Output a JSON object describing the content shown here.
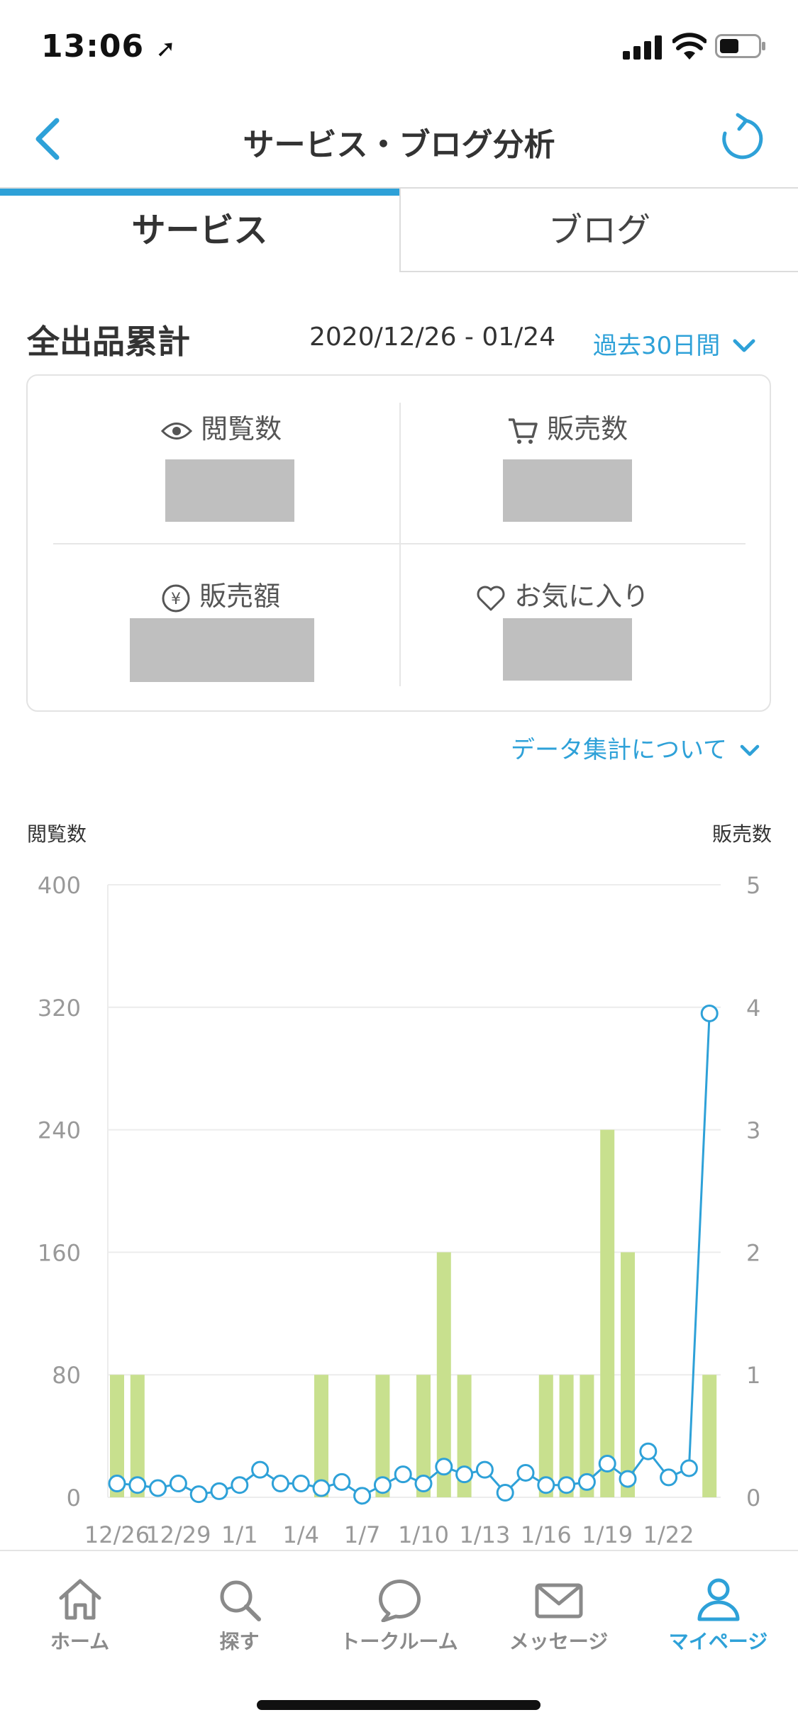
{
  "status": {
    "time": "13:06"
  },
  "header": {
    "title": "サービス・ブログ分析"
  },
  "tabs": [
    {
      "label": "サービス",
      "active": true
    },
    {
      "label": "ブログ",
      "active": false
    }
  ],
  "summary": {
    "title": "全出品累計",
    "date_range": "2020/12/26 - 01/24",
    "period": "過去30日間",
    "stats": {
      "views": "閲覧数",
      "sales_count": "販売数",
      "sales_amount": "販売額",
      "favorites": "お気に入り"
    },
    "about_link": "データ集計について"
  },
  "colors": {
    "accent": "#2ea1d8",
    "bar": "#c8e08e",
    "line": "#2ea1d8"
  },
  "chart_data": {
    "type": "bar",
    "left_label": "閲覧数",
    "right_label": "販売数",
    "ylim_left": [
      0,
      400
    ],
    "ylim_right": [
      0,
      5
    ],
    "yticks_left": [
      "0",
      "80",
      "160",
      "240",
      "320",
      "400"
    ],
    "yticks_right": [
      "0",
      "1",
      "2",
      "3",
      "4",
      "5"
    ],
    "x_tick_labels": [
      "12/26",
      "12/29",
      "1/1",
      "1/4",
      "1/7",
      "1/10",
      "1/13",
      "1/16",
      "1/19",
      "1/22"
    ],
    "x_tick_index": [
      0,
      3,
      6,
      9,
      12,
      15,
      18,
      21,
      24,
      27
    ],
    "series": [
      {
        "name": "販売数",
        "type": "bar",
        "axis": "right",
        "values": [
          1,
          1,
          0,
          0,
          0,
          0,
          0,
          0,
          0,
          0,
          1,
          0,
          0,
          1,
          0,
          1,
          2,
          1,
          0,
          0,
          0,
          1,
          1,
          1,
          3,
          2,
          0,
          0,
          0,
          1
        ]
      },
      {
        "name": "閲覧数",
        "type": "line",
        "axis": "left",
        "values": [
          9,
          8,
          6,
          9,
          2,
          4,
          8,
          18,
          9,
          9,
          6,
          10,
          1,
          8,
          15,
          9,
          20,
          15,
          18,
          3,
          16,
          8,
          8,
          10,
          22,
          12,
          30,
          13,
          19,
          316
        ]
      }
    ]
  },
  "bottom_nav": [
    {
      "label": "ホーム",
      "icon": "home-icon",
      "active": false
    },
    {
      "label": "探す",
      "icon": "search-icon",
      "active": false
    },
    {
      "label": "トークルーム",
      "icon": "chat-bubble-icon",
      "active": false
    },
    {
      "label": "メッセージ",
      "icon": "mail-icon",
      "active": false
    },
    {
      "label": "マイページ",
      "icon": "user-icon",
      "active": true
    }
  ]
}
